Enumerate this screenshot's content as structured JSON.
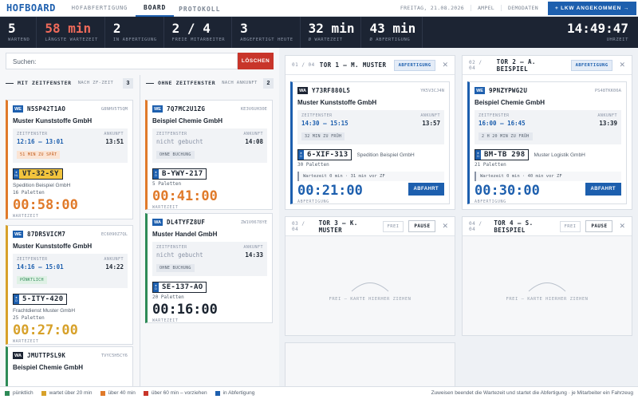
{
  "nav": {
    "brand": "HOFBOARD",
    "tabs": [
      "HOFABFERTIGUNG",
      "BOARD",
      "PROTOKOLL"
    ],
    "date": "FREITAG, 21.08.2026",
    "user": "AMPEL",
    "mode": "DEMODATEN",
    "arrive_button": "+ LKW ANGEKOMMEN →"
  },
  "stats": [
    {
      "value": "5",
      "label": "WARTEND"
    },
    {
      "value": "58 min",
      "label": "LÄNGSTE WARTEZEIT"
    },
    {
      "value": "2",
      "label": "IN ABFERTIGUNG"
    },
    {
      "value": "2 / 4",
      "label": "FREIE MITARBEITER"
    },
    {
      "value": "3",
      "label": "ABGEFERTIGT HEUTE"
    },
    {
      "value": "32 min",
      "label": "Ø WARTEZEIT"
    },
    {
      "value": "43 min",
      "label": "Ø ABFERTIGUNG"
    }
  ],
  "clock": {
    "value": "14:49:47",
    "label": "UHRZEIT"
  },
  "search": {
    "placeholder": "Suchen:",
    "clear": "LÖSCHEN"
  },
  "columns": {
    "with": {
      "title": "MIT ZEITFENSTER",
      "sub": "NACH ZF-ZEIT",
      "count": "3"
    },
    "without": {
      "title": "OHNE ZEITFENSTER",
      "sub": "NACH ANKUNFT",
      "count": "2"
    }
  },
  "labels": {
    "zeitfenster": "ZEITFENSTER",
    "ankunft": "ANKUNFT",
    "wartezeit": "WARTEZEIT",
    "abfertigung": "ABFERTIGUNG",
    "abfahrt": "ABFAHRT",
    "frei": "FREI – KARTE HIERHER ZIEHEN"
  },
  "queue_with": [
    {
      "type": "WE",
      "code": "N5SP42T1AO",
      "ref": "G8NHV5T5QM",
      "company": "Muster Kunststoffe GmbH",
      "window": "12:16 – 13:01",
      "arrival": "13:51",
      "badge": "51 MIN ZU SPÄT",
      "plate": "VT-32-SY",
      "carrier": "Spedition Beispiel GmbH",
      "pallets": "16 Paletten",
      "wait": "00:58:00"
    },
    {
      "type": "WE",
      "code": "87DRSVICM7",
      "ref": "EC6090Z7QL",
      "company": "Muster Kunststoffe GmbH",
      "window": "14:16 – 15:01",
      "arrival": "14:22",
      "badge": "PÜNKTLICH",
      "plate": "5-ITY-420",
      "carrier": "Frachtdienst Muster GmbH",
      "pallets": "25 Paletten",
      "wait": "00:27:00"
    },
    {
      "type": "WA",
      "code": "JMUTTPSL9K",
      "ref": "TVYC5H5CY6",
      "company": "Beispiel Chemie GmbH"
    }
  ],
  "queue_without": [
    {
      "type": "WE",
      "code": "7Q7MC2U1ZG",
      "ref": "KE3V6UH30E",
      "company": "Beispiel Chemie GmbH",
      "window": "nicht gebucht",
      "arrival": "14:08",
      "badge": "OHNE BUCHUNG",
      "plate": "B-YWY-217",
      "pallets": "5 Paletten",
      "wait": "00:41:00"
    },
    {
      "type": "WA",
      "code": "DL4TYFZ8UF",
      "ref": "ZW1V0678YE",
      "company": "Muster Handel GmbH",
      "window": "nicht gebucht",
      "arrival": "14:33",
      "badge": "OHNE BUCHUNG",
      "plate": "SE-137-AO",
      "pallets": "20 Paletten",
      "wait": "00:16:00"
    }
  ],
  "gates": [
    {
      "idx": "01 / 04",
      "name": "TOR 1 – M. MUSTER",
      "status": "ABFERTIGUNG",
      "truck": {
        "type": "WA",
        "code": "Y73RF880L5",
        "ref": "YK5V3CJ4N",
        "company": "Muster Kunststoffe GmbH",
        "window": "14:30 – 15:15",
        "arrival": "13:57",
        "badge": "32 MIN ZU FRÜH",
        "plate": "6-XIF-313",
        "carrier": "Spedition Beispiel GmbH",
        "pallets": "30 Paletten",
        "waitnote": "Wartezeit 0 min · 31 min vor ZF",
        "timer": "00:21:00",
        "button": "ABFAHRT"
      }
    },
    {
      "idx": "02 / 04",
      "name": "TOR 2 – A. BEISPIEL",
      "status": "ABFERTIGUNG",
      "truck": {
        "type": "WE",
        "code": "9PNZYPWG2U",
        "ref": "PS48TKK06A",
        "company": "Beispiel Chemie GmbH",
        "window": "16:00 – 16:45",
        "arrival": "13:39",
        "badge": "2 H 20 MIN ZU FRÜH",
        "plate": "BM-TB 298",
        "carrier": "Muster Logistik GmbH",
        "pallets": "21 Paletten",
        "waitnote": "Wartezeit 0 min · 40 min vor ZF",
        "timer": "00:30:00",
        "button": "ABFAHRT"
      }
    },
    {
      "idx": "03 / 04",
      "name": "TOR 3 – K. MUSTER",
      "status": "FREI",
      "pause": "PAUSE"
    },
    {
      "idx": "04 / 04",
      "name": "TOR 4 – S. BEISPIEL",
      "status": "FREI",
      "pause": "PAUSE"
    }
  ],
  "legend": [
    {
      "label": "pünktlich",
      "color": "#2e8b57"
    },
    {
      "label": "wartet über 20 min",
      "color": "#d7a12a"
    },
    {
      "label": "über 40 min",
      "color": "#e07a2a"
    },
    {
      "label": "über 60 min – vorziehen",
      "color": "#c8352a"
    },
    {
      "label": "in Abfertigung",
      "color": "#1d5fae"
    }
  ],
  "hint": "Zuweisen beendet die Wartezeit und startet die Abfertigung · je Mitarbeiter ein Fahrzeug"
}
